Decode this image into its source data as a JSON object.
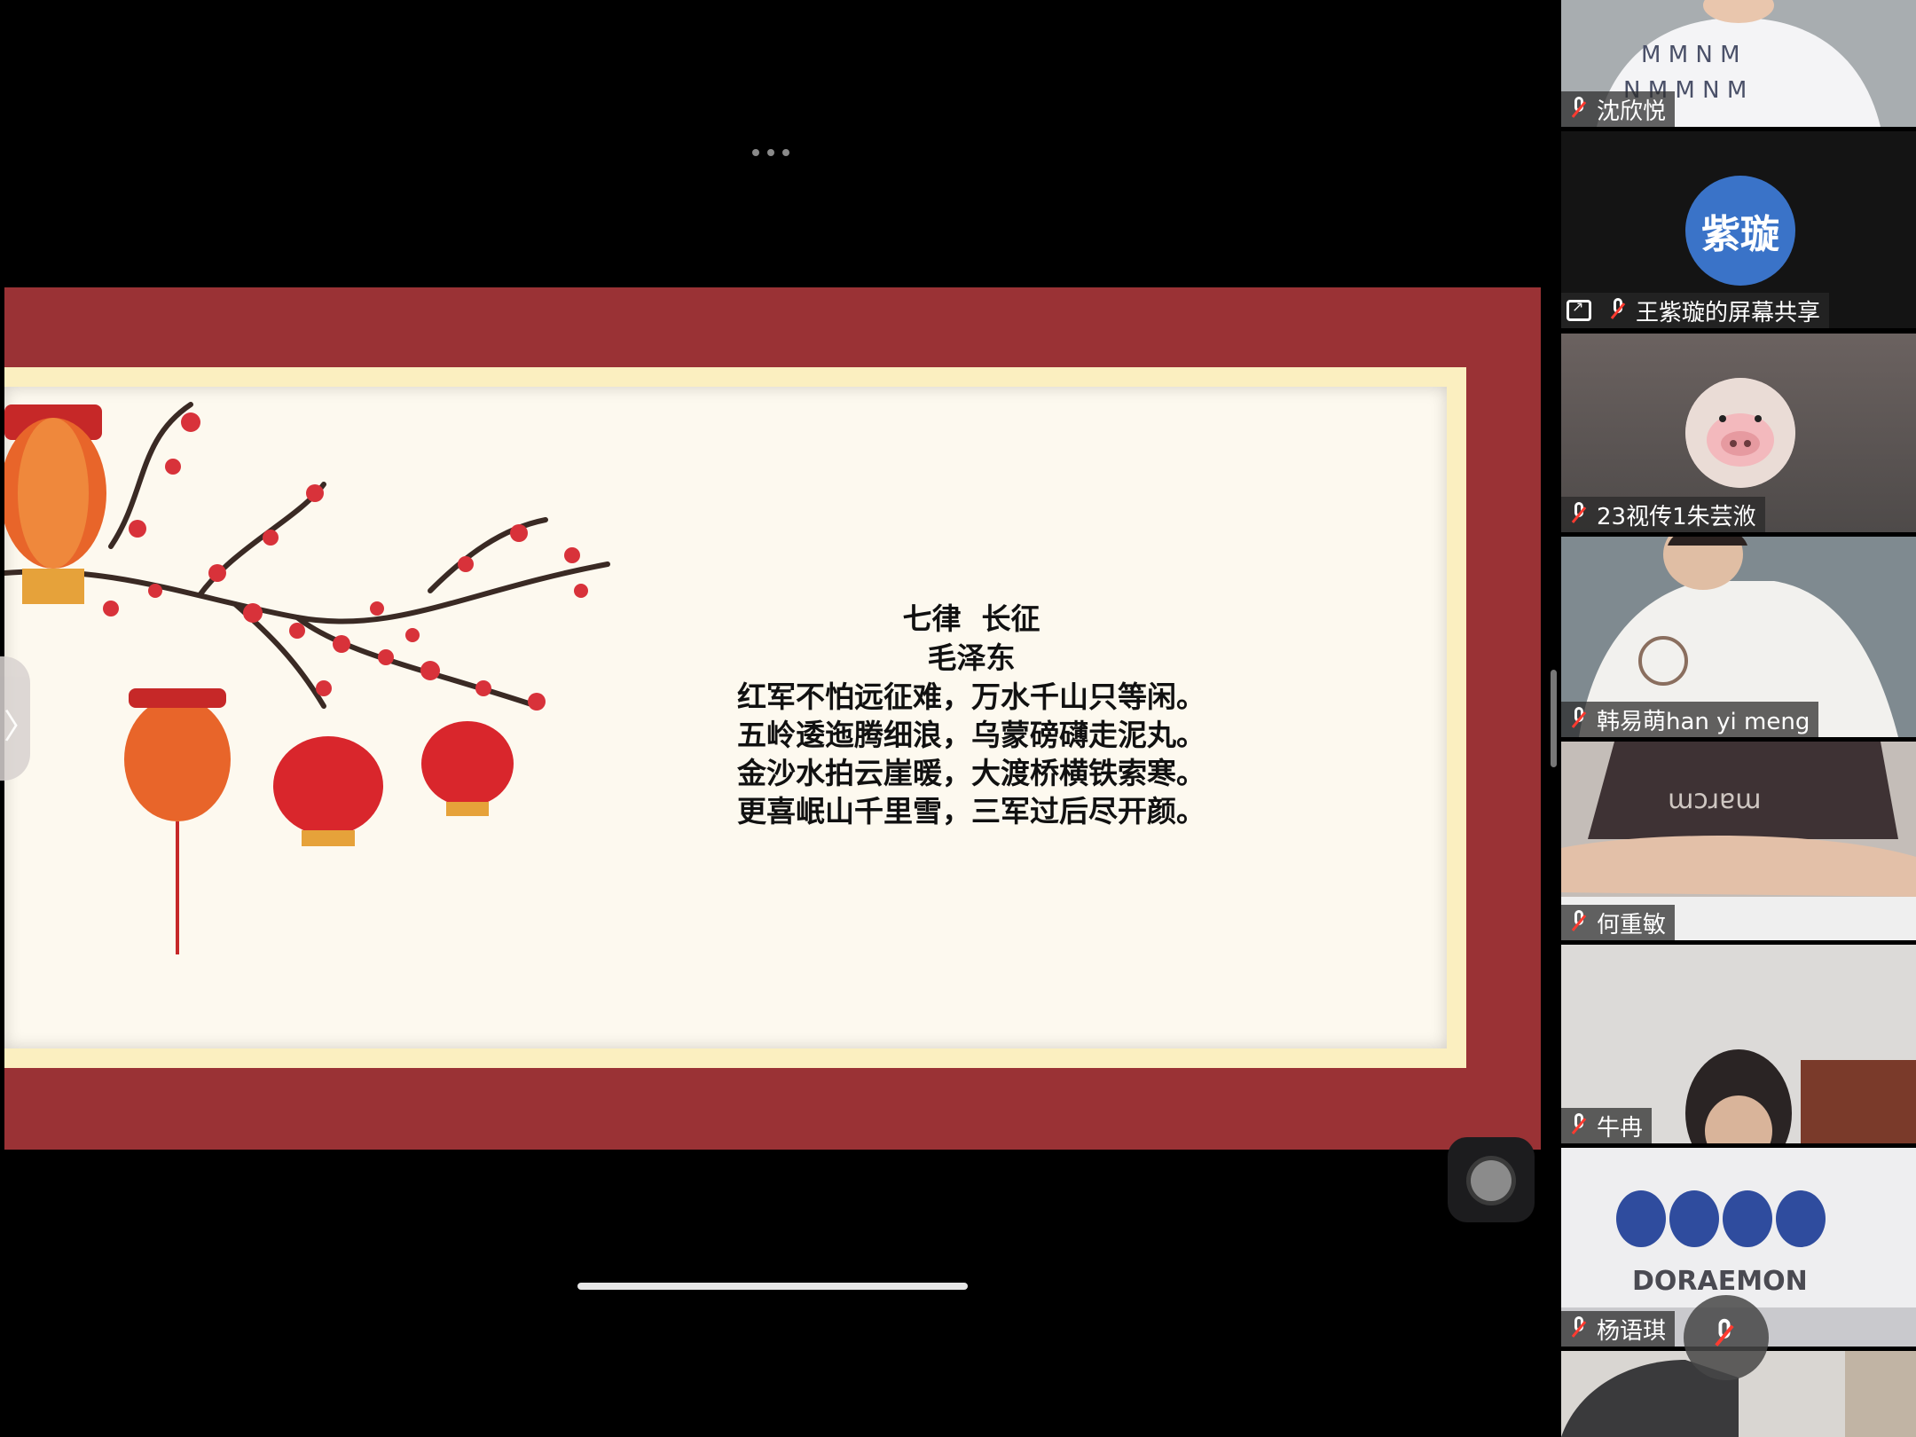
{
  "slide": {
    "poem": {
      "title": "七律  长征",
      "author": "毛泽东",
      "lines": [
        "红军不怕远征难，万水千山只等闲。",
        "五岭逶迤腾细浪，乌蒙磅礴走泥丸。",
        "金沙水拍云崖暖，大渡桥横铁索寒。",
        "更喜岷山千里雪，三军过后尽开颜。"
      ]
    }
  },
  "ui": {
    "edge_tab_glyph": "〉"
  },
  "participants": [
    {
      "name": "沈欣悦",
      "muted": true,
      "type": "video"
    },
    {
      "name": "王紫璇的屏幕共享",
      "avatar_text": "紫璇",
      "avatar_color": "#3a73c8",
      "muted": true,
      "sharing": true,
      "type": "avatar"
    },
    {
      "name": "23视传1朱芸浟",
      "muted": true,
      "type": "avatar-image"
    },
    {
      "name": "韩易萌han yi meng",
      "muted": true,
      "type": "video"
    },
    {
      "name": "何重敏",
      "muted": true,
      "type": "video"
    },
    {
      "name": "牛冉",
      "muted": true,
      "type": "video"
    },
    {
      "name": "杨语琪",
      "muted": true,
      "type": "video",
      "shirt_text": "DORAEMON"
    },
    {
      "name": "",
      "type": "video"
    }
  ],
  "colors": {
    "slide_border": "#9a3235",
    "slide_mat": "#fbefc0",
    "slide_paper": "#fdf9ef",
    "muted_red": "#ff3b30"
  }
}
